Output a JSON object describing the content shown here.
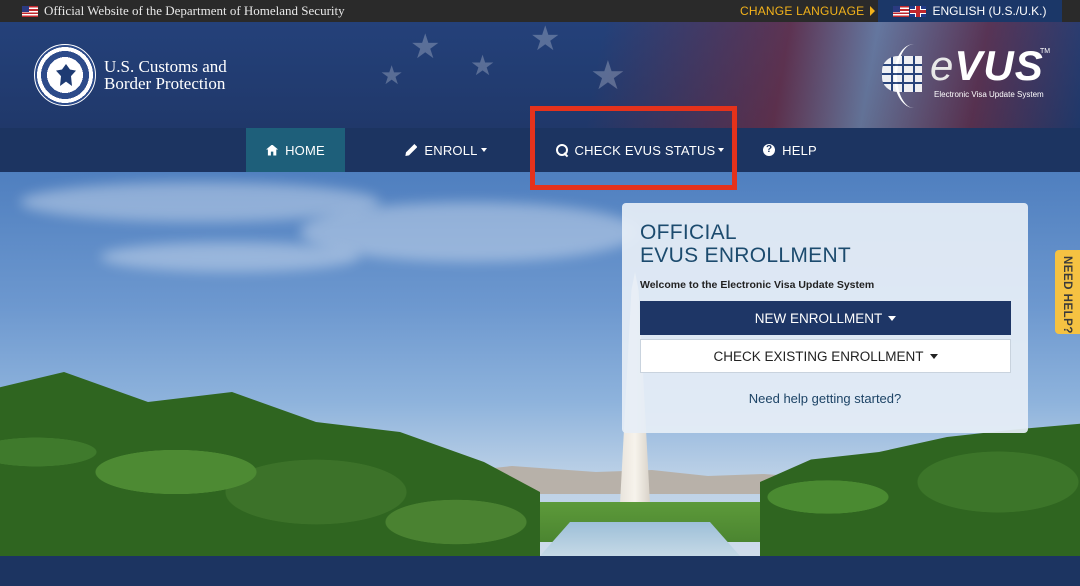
{
  "topbar": {
    "official_text": "Official Website of the Department of Homeland Security",
    "change_language": "CHANGE LANGUAGE",
    "language": "ENGLISH (U.S./U.K.)"
  },
  "header": {
    "agency_line1": "U.S. Customs and",
    "agency_line2": "Border Protection",
    "logo_word": "VUS",
    "logo_e": "e",
    "logo_tm": "TM",
    "logo_sub": "Electronic Visa Update System"
  },
  "nav": {
    "items": [
      {
        "label": "HOME",
        "icon": "home-icon",
        "active": true
      },
      {
        "label": "ENROLL",
        "icon": "pencil-icon",
        "dropdown": true
      },
      {
        "label": "CHECK EVUS STATUS",
        "icon": "search-icon",
        "dropdown": true
      },
      {
        "label": "HELP",
        "icon": "question-circle-icon"
      }
    ]
  },
  "panel": {
    "title_line1": "OFFICIAL",
    "title_line2": "EVUS ENROLLMENT",
    "welcome": "Welcome to the Electronic Visa Update System",
    "new_enrollment": "NEW ENROLLMENT",
    "check_existing": "CHECK EXISTING ENROLLMENT",
    "help_link": "Need help getting started?"
  },
  "side_tab": {
    "label": "NEED HELP?"
  },
  "colors": {
    "nav_bg": "#1c3461",
    "nav_active": "#1e5f7a",
    "primary_button": "#1e3666",
    "highlight": "#e5321b",
    "change_language": "#f2b21b",
    "side_tab": "#f5c242"
  }
}
